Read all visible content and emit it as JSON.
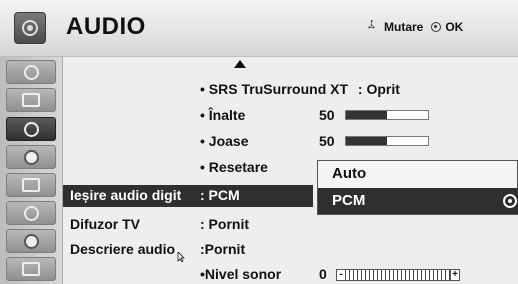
{
  "header": {
    "title": "AUDIO",
    "hint_move": "Mutare",
    "hint_ok": "OK"
  },
  "sidebar": {
    "items": [
      {
        "name": "picture-icon"
      },
      {
        "name": "screen-icon"
      },
      {
        "name": "audio-icon",
        "active": true
      },
      {
        "name": "time-icon"
      },
      {
        "name": "option-icon"
      },
      {
        "name": "lock-icon"
      },
      {
        "name": "bluetooth-icon"
      },
      {
        "name": "movie-icon"
      }
    ]
  },
  "menu": {
    "srs": {
      "label": "• SRS TruSurround XT",
      "value": ": Oprit"
    },
    "treble": {
      "label": "• Înalte",
      "value": "50",
      "level": 0.5
    },
    "bass": {
      "label": "• Joase",
      "value": "50",
      "level": 0.5
    },
    "reset": {
      "label": "• Resetare"
    },
    "digital_out": {
      "label": "Ieșire audio digit",
      "value": ": PCM"
    },
    "tv_speaker": {
      "label": "Difuzor TV",
      "value": ": Pornit"
    },
    "audio_desc": {
      "label": "Descriere audio",
      "value": ":Pornit"
    },
    "volume": {
      "label": "•Nivel sonor",
      "value": "0",
      "minus": "-",
      "plus": "+"
    }
  },
  "popup": {
    "options": [
      "Auto",
      "PCM"
    ],
    "selected": "PCM"
  }
}
